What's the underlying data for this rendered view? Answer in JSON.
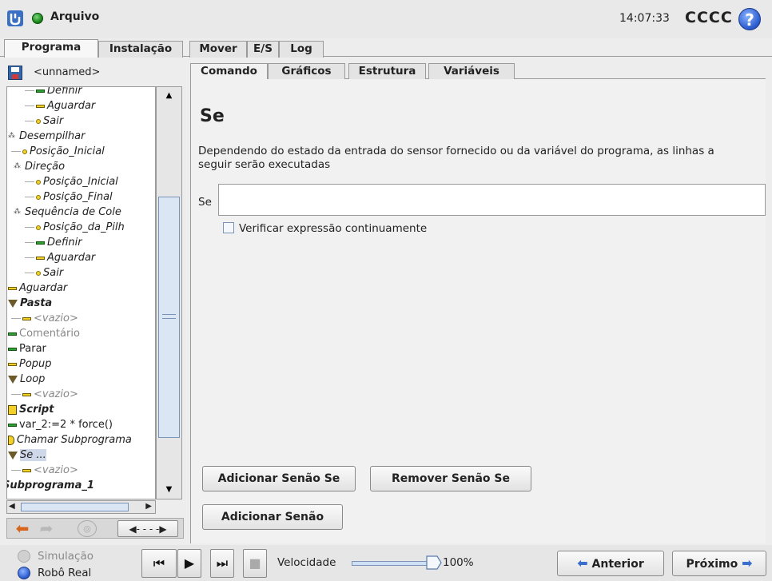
{
  "header": {
    "file_title": "Arquivo",
    "clock": "14:07:33",
    "robot_name": "CCCC",
    "help": "?"
  },
  "main_tabs": [
    "Programa",
    "Instalação",
    "Mover",
    "E/S",
    "Log"
  ],
  "tree": {
    "program_name": "<unnamed>",
    "nodes": [
      {
        "label": "Definir",
        "icon": "bar-green"
      },
      {
        "label": "Aguardar",
        "icon": "bar-yellow"
      },
      {
        "label": "Sair",
        "icon": "dot"
      },
      {
        "label": "Desempilhar",
        "icon": "dots"
      },
      {
        "label": "Posição_Inicial",
        "icon": "dot"
      },
      {
        "label": "Direção",
        "icon": "dots"
      },
      {
        "label": "Posição_Inicial",
        "icon": "dot"
      },
      {
        "label": "Posição_Final",
        "icon": "dot"
      },
      {
        "label": "Sequência de Cole",
        "icon": "dots"
      },
      {
        "label": "Posição_da_Pilh",
        "icon": "dot"
      },
      {
        "label": "Definir",
        "icon": "bar-green"
      },
      {
        "label": "Aguardar",
        "icon": "bar-yellow"
      },
      {
        "label": "Sair",
        "icon": "dot"
      },
      {
        "label": "Aguardar",
        "icon": "bar-yellow"
      },
      {
        "label": "Pasta",
        "icon": "triangle"
      },
      {
        "label": "<vazio>",
        "icon": "bar-yellow"
      },
      {
        "label": "Comentário",
        "icon": "bar-green"
      },
      {
        "label": "Parar",
        "icon": "bar-green"
      },
      {
        "label": "Popup",
        "icon": "bar-yellow"
      },
      {
        "label": "Loop",
        "icon": "triangle"
      },
      {
        "label": "<vazio>",
        "icon": "bar-yellow"
      },
      {
        "label": "Script",
        "icon": "script"
      },
      {
        "label": "var_2:=2 * force()",
        "icon": "bar-green"
      },
      {
        "label": "Chamar Subprograma",
        "icon": "subprogram"
      },
      {
        "label": "Se ...",
        "icon": "triangle"
      },
      {
        "label": "<vazio>",
        "icon": "bar-yellow"
      },
      {
        "label": "Subprograma_1",
        "icon": "none"
      }
    ]
  },
  "sub_tabs": [
    "Comando",
    "Gráficos",
    "Estrutura",
    "Variáveis"
  ],
  "command": {
    "title": "Se",
    "description": "Dependendo do estado da entrada do sensor fornecido ou da variável do programa, as linhas a seguir serão executadas",
    "se_label": "Se",
    "expression_value": "",
    "check_label": "Verificar expressão continuamente",
    "check_checked": false,
    "btn_add_else_if": "Adicionar Senão Se",
    "btn_remove_else_if": "Remover Senão Se",
    "btn_add_else": "Adicionar Senão"
  },
  "footer": {
    "sim_label": "Simulação",
    "real_label": "Robô Real",
    "speed_label": "Velocidade",
    "speed_value": "100%",
    "speed_fraction": 1.0,
    "prev_label": "Anterior",
    "next_label": "Próximo"
  },
  "colors": {
    "accent_blue": "#3a6fd0",
    "status_green": "#1a8a1a",
    "selection": "#cfd8e8"
  }
}
